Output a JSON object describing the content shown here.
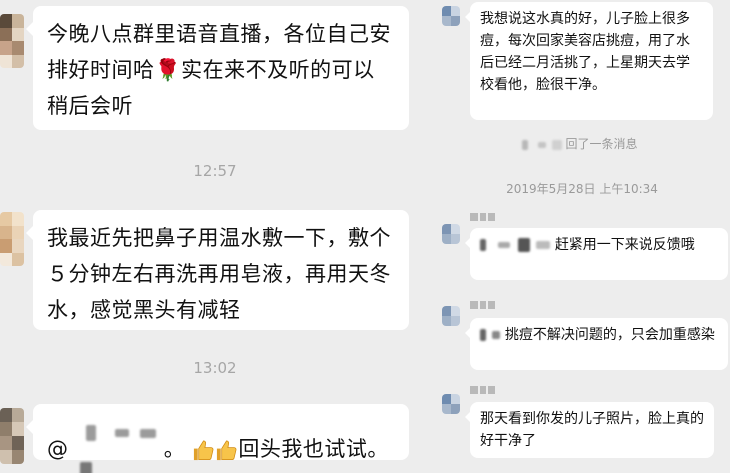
{
  "left": {
    "messages": [
      {
        "text": "今晚八点群里语音直播，各位自己安排好时间哈🌹实在来不及听的可以稍后会听"
      },
      {
        "time": "12:57"
      },
      {
        "text": "我最近先把鼻子用温水敷一下，敷个５分钟左右再洗再用皂液，再用天冬水，感觉黑头有减轻"
      },
      {
        "time": "13:02"
      },
      {
        "prefix": "@",
        "suffix_char": "。",
        "text_after": "回头我也试试。"
      }
    ]
  },
  "right": {
    "msg1": "我想说这水真的好，儿子脸上很多痘，每次回家美容店挑痘，用了水后已经二月活挑了，上星期天去学校看他，脸很干净。",
    "recall": "回了一条消息",
    "date": "2019年5月28日 上午10:34",
    "msg2": "赶紧用一下来说反馈哦",
    "msg3": "挑痘不解决问题的，只会加重感染",
    "msg4": "那天看到你发的儿子照片，脸上真的好干净了"
  }
}
